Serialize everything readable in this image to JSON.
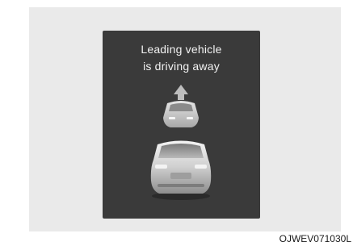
{
  "display": {
    "message_line1": "Leading vehicle",
    "message_line2": "is driving away",
    "arrow_icon": "up-arrow-icon",
    "leading_vehicle_icon": "leading-vehicle-icon",
    "own_vehicle_icon": "own-vehicle-icon"
  },
  "figure": {
    "code": "OJWEV071030L"
  },
  "colors": {
    "panel_background": "#eaeaea",
    "screen_background": "#3a3a3a",
    "message_text": "#f2f2f2"
  }
}
